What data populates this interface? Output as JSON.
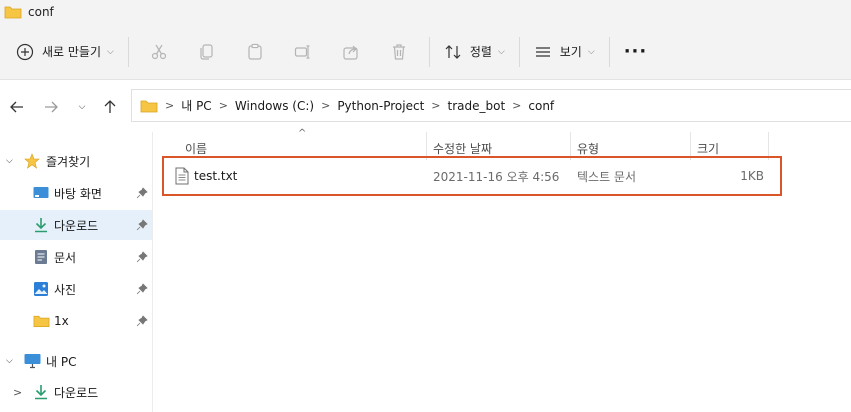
{
  "window": {
    "title": "conf",
    "folder_icon": "folder-icon"
  },
  "toolbar": {
    "new_label": "새로 만들기",
    "sort_label": "정렬",
    "view_label": "보기",
    "more_label": "···",
    "icons": [
      "cut-icon",
      "copy-icon",
      "paste-icon",
      "rename-icon",
      "share-icon",
      "delete-icon"
    ]
  },
  "address": {
    "segments": [
      "내 PC",
      "Windows (C:)",
      "Python-Project",
      "trade_bot",
      "conf"
    ]
  },
  "sidebar": {
    "items": [
      {
        "label": "즐겨찾기",
        "icon": "star-icon"
      },
      {
        "label": "바탕 화면",
        "icon": "desktop-icon"
      },
      {
        "label": "다운로드",
        "icon": "download-icon"
      },
      {
        "label": "문서",
        "icon": "document-icon"
      },
      {
        "label": "사진",
        "icon": "pictures-icon"
      },
      {
        "label": "1x",
        "icon": "folder-icon"
      },
      {
        "label": "내 PC",
        "icon": "pc-icon"
      },
      {
        "label": "다운로드",
        "icon": "download-icon"
      }
    ]
  },
  "columns": {
    "name": "이름",
    "modified": "수정한 날짜",
    "type": "유형",
    "size": "크기"
  },
  "files": [
    {
      "name": "test.txt",
      "modified": "2021-11-16 오후 4:56",
      "type": "텍스트 문서",
      "size": "1KB"
    }
  ],
  "colors": {
    "selection_border": "#d9562b",
    "sidebar_selected": "#e5f0fa",
    "folder_yellow": "#f6c544",
    "download_green": "#2a9d6f",
    "accent_blue": "#2b7fd6"
  }
}
